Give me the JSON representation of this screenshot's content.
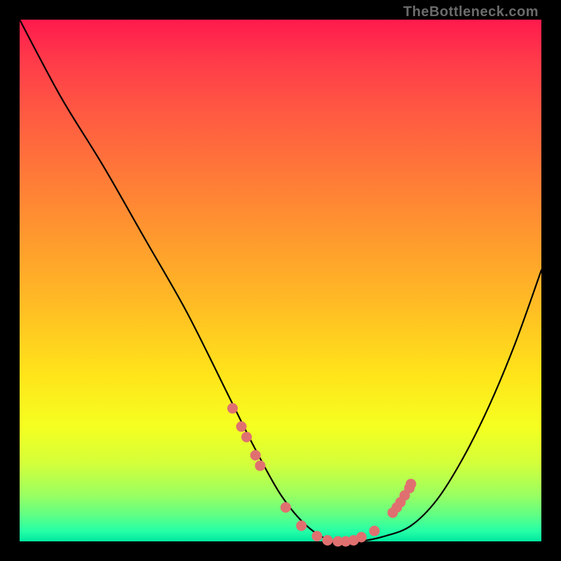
{
  "watermark": "TheBottleneck.com",
  "chart_data": {
    "type": "line",
    "title": "",
    "xlabel": "",
    "ylabel": "",
    "xlim": [
      0,
      100
    ],
    "ylim": [
      0,
      100
    ],
    "series": [
      {
        "name": "curve",
        "x": [
          0,
          8,
          16,
          24,
          32,
          40,
          45,
          50,
          55,
          60,
          65,
          70,
          75,
          80,
          85,
          90,
          95,
          100
        ],
        "y": [
          100,
          85,
          72,
          58,
          44,
          28,
          18,
          9,
          3,
          0,
          0,
          1,
          3,
          8,
          16,
          26,
          38,
          52
        ]
      }
    ],
    "markers": {
      "name": "highlight-dots",
      "color": "#e07070",
      "x": [
        40.8,
        42.5,
        43.5,
        45.2,
        46.1,
        51.0,
        54.0,
        57.0,
        59.0,
        61.0,
        62.5,
        64.0,
        65.5,
        68.0,
        71.5,
        72.3,
        73.0,
        73.8,
        74.7,
        75.0
      ],
      "y": [
        25.5,
        22.0,
        20.0,
        16.5,
        14.5,
        6.5,
        3.0,
        1.0,
        0.2,
        0.0,
        0.0,
        0.2,
        0.8,
        2.0,
        5.5,
        6.5,
        7.5,
        8.8,
        10.2,
        11.0
      ]
    }
  }
}
